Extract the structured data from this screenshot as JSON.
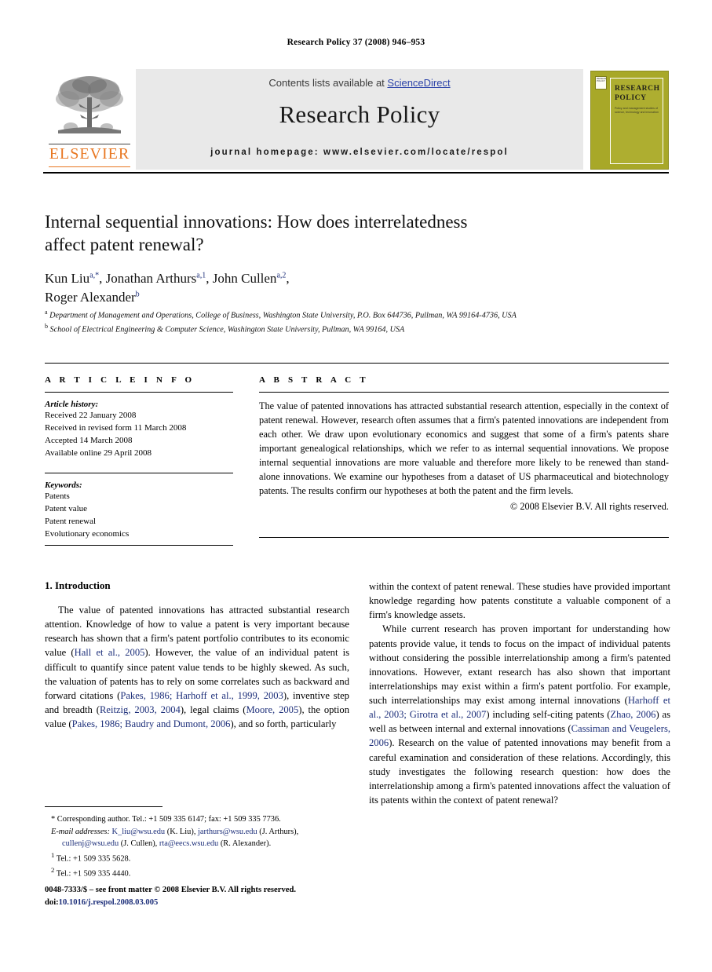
{
  "running_head": "Research Policy 37 (2008) 946–953",
  "masthead": {
    "contents_prefix": "Contents lists available at ",
    "sciencedirect": "ScienceDirect",
    "journal_title": "Research Policy",
    "homepage": "journal homepage: www.elsevier.com/locate/respol",
    "publisher_logo_text": "ELSEVIER",
    "cover": {
      "title": "RESEARCH POLICY",
      "subtitle": "Policy and management studies of science, technology and innovation",
      "stamp": "RESEARCH POLICY"
    },
    "link_color": "#2b42a8",
    "band_color": "#e9e9e9",
    "cover_color": "#a8a828",
    "elsevier_orange": "#e87722"
  },
  "article": {
    "title": "Internal sequential innovations: How does interrelatedness affect patent renewal?",
    "authors": [
      {
        "name": "Kun Liu",
        "sup": "a,*"
      },
      {
        "name": "Jonathan Arthurs",
        "sup": "a,1"
      },
      {
        "name": "John Cullen",
        "sup": "a,2"
      },
      {
        "name": "Roger Alexander",
        "sup": "b"
      }
    ],
    "authors_line_1": "Kun Liu",
    "authors_line_2": "Roger Alexander",
    "affiliations": [
      {
        "marker": "a",
        "text": "Department of Management and Operations, College of Business, Washington State University, P.O. Box 644736, Pullman, WA 99164-4736, USA"
      },
      {
        "marker": "b",
        "text": "School of Electrical Engineering & Computer Science, Washington State University, Pullman, WA 99164, USA"
      }
    ]
  },
  "article_info": {
    "label": "A R T I C L E  I N F O",
    "history_heading": "Article history:",
    "history": [
      "Received 22 January 2008",
      "Received in revised form 11 March 2008",
      "Accepted 14 March 2008",
      "Available online 29 April 2008"
    ],
    "keywords_heading": "Keywords:",
    "keywords": [
      "Patents",
      "Patent value",
      "Patent renewal",
      "Evolutionary economics"
    ]
  },
  "abstract": {
    "label": "A B S T R A C T",
    "text": "The value of patented innovations has attracted substantial research attention, especially in the context of patent renewal. However, research often assumes that a firm's patented innovations are independent from each other. We draw upon evolutionary economics and suggest that some of a firm's patents share important genealogical relationships, which we refer to as internal sequential innovations. We propose internal sequential innovations are more valuable and therefore more likely to be renewed than stand-alone innovations. We examine our hypotheses from a dataset of US pharmaceutical and biotechnology patents. The results confirm our hypotheses at both the patent and the firm levels.",
    "copyright": "© 2008 Elsevier B.V. All rights reserved."
  },
  "introduction": {
    "heading": "1.  Introduction",
    "left_paragraph_1_parts": [
      {
        "t": "The value of patented innovations has attracted substantial research attention. Knowledge of how to value a patent is very important because research has shown that a firm's patent portfolio contributes to its economic value (",
        "cite": false
      },
      {
        "t": "Hall et al., 2005",
        "cite": true
      },
      {
        "t": "). However, the value of an individual patent is difficult to quantify since patent value tends to be highly skewed. As such, the valuation of patents has to rely on some correlates such as backward and forward citations (",
        "cite": false
      },
      {
        "t": "Pakes, 1986; Harhoff et al., 1999, 2003",
        "cite": true
      },
      {
        "t": "), inventive step and breadth (",
        "cite": false
      },
      {
        "t": "Reitzig, 2003, 2004",
        "cite": true
      },
      {
        "t": "), legal claims (",
        "cite": false
      },
      {
        "t": "Moore, 2005",
        "cite": true
      },
      {
        "t": "), the option value (",
        "cite": false
      },
      {
        "t": "Pakes, 1986; Baudry and Dumont, 2006",
        "cite": true
      },
      {
        "t": "), and so forth, particularly",
        "cite": false
      }
    ],
    "right_paragraph_1_parts": [
      {
        "t": "within the context of patent renewal. These studies have provided important knowledge regarding how patents constitute a valuable component of a firm's knowledge assets.",
        "cite": false
      }
    ],
    "right_paragraph_2_parts": [
      {
        "t": "While current research has proven important for understanding how patents provide value, it tends to focus on the impact of individual patents without considering the possible interrelationship among a firm's patented innovations. However, extant research has also shown that important interrelationships may exist within a firm's patent portfolio. For example, such interrelationships may exist among internal innovations (",
        "cite": false
      },
      {
        "t": "Harhoff et al., 2003; Girotra et al., 2007",
        "cite": true
      },
      {
        "t": ") including self-citing patents (",
        "cite": false
      },
      {
        "t": "Zhao, 2006",
        "cite": true
      },
      {
        "t": ") as well as between internal and external innovations (",
        "cite": false
      },
      {
        "t": "Cassiman and Veugelers, 2006",
        "cite": true
      },
      {
        "t": "). Research on the value of patented innovations may benefit from a careful examination and consideration of these relations. Accordingly, this study investigates the following research question: how does the interrelationship among a firm's patented innovations affect the valuation of its patents within the context of patent renewal?",
        "cite": false
      }
    ]
  },
  "footnotes": {
    "corresponding": "* Corresponding author. Tel.: +1 509 335 6147; fax: +1 509 335 7736.",
    "email_label": "E-mail addresses:",
    "emails": [
      {
        "address": "K_liu@wsu.edu",
        "owner": "(K. Liu)"
      },
      {
        "address": "jarthurs@wsu.edu",
        "owner": "(J. Arthurs)"
      },
      {
        "address": "cullenj@wsu.edu",
        "owner": "(J. Cullen)"
      },
      {
        "address": "rta@eecs.wsu.edu",
        "owner": "(R. Alexander)"
      }
    ],
    "note_1": "Tel.: +1 509 335 5628.",
    "note_2": "Tel.: +1 509 335 4440."
  },
  "imprint": {
    "front_matter": "0048-7333/$ – see front matter © 2008 Elsevier B.V. All rights reserved.",
    "doi_label": "doi:",
    "doi": "10.1016/j.respol.2008.03.005"
  }
}
